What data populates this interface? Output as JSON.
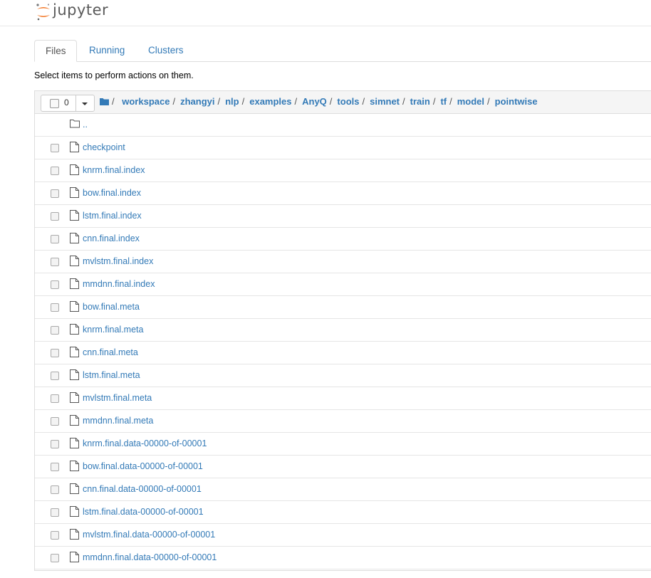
{
  "app": {
    "name": "jupyter"
  },
  "tabs": [
    {
      "label": "Files"
    },
    {
      "label": "Running"
    },
    {
      "label": "Clusters"
    }
  ],
  "hint": "Select items to perform actions on them.",
  "toolbar": {
    "selected_count": "0"
  },
  "breadcrumb": [
    "workspace",
    "zhangyi",
    "nlp",
    "examples",
    "AnyQ",
    "tools",
    "simnet",
    "train",
    "tf",
    "model",
    "pointwise"
  ],
  "parent_dir": "..",
  "files": [
    "checkpoint",
    "knrm.final.index",
    "bow.final.index",
    "lstm.final.index",
    "cnn.final.index",
    "mvlstm.final.index",
    "mmdnn.final.index",
    "bow.final.meta",
    "knrm.final.meta",
    "cnn.final.meta",
    "lstm.final.meta",
    "mvlstm.final.meta",
    "mmdnn.final.meta",
    "knrm.final.data-00000-of-00001",
    "bow.final.data-00000-of-00001",
    "cnn.final.data-00000-of-00001",
    "lstm.final.data-00000-of-00001",
    "mvlstm.final.data-00000-of-00001",
    "mmdnn.final.data-00000-of-00001"
  ],
  "colors": {
    "link": "#337ab7",
    "logo_orange": "#f37726"
  }
}
